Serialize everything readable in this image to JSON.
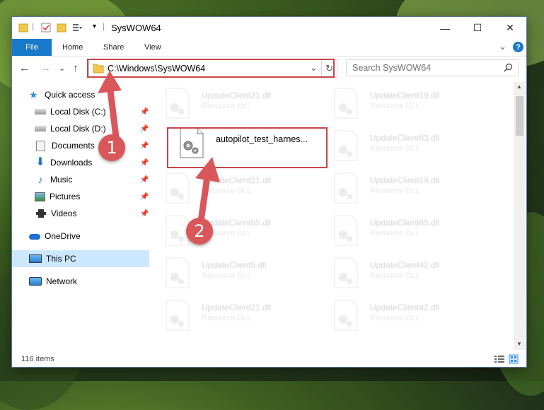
{
  "window": {
    "title": "SysWOW64",
    "minimize": "—",
    "maximize": "☐",
    "close": "✕"
  },
  "ribbon": {
    "file": "File",
    "tabs": [
      "Home",
      "Share",
      "View"
    ],
    "expand": "⌄",
    "help": "?"
  },
  "address": {
    "path": "C:\\Windows\\SysWOW64",
    "refresh": "↻",
    "dropdown": "⌄",
    "search_placeholder": "Search SysWOW64"
  },
  "nav": {
    "back": "←",
    "forward": "→",
    "recent": "⌄",
    "up": "↑"
  },
  "sidebar": {
    "quick_access": "Quick access",
    "items": [
      {
        "label": "Local Disk (C:)",
        "icon": "drive-icon",
        "pinned": true
      },
      {
        "label": "Local Disk (D:)",
        "icon": "drive-icon",
        "pinned": true
      },
      {
        "label": "Documents",
        "icon": "documents-icon",
        "pinned": true
      },
      {
        "label": "Downloads",
        "icon": "downloads-icon",
        "pinned": true
      },
      {
        "label": "Music",
        "icon": "music-icon",
        "pinned": true
      },
      {
        "label": "Pictures",
        "icon": "pictures-icon",
        "pinned": true
      },
      {
        "label": "Videos",
        "icon": "videos-icon",
        "pinned": true
      }
    ],
    "onedrive": "OneDrive",
    "thispc": "This PC",
    "network": "Network",
    "pin_glyph": "📌"
  },
  "files": {
    "highlighted": {
      "name": "autopilot_test_harnes...",
      "type": ""
    },
    "left_column": [
      {
        "name": "UpdateClient21.dll",
        "type": "Resource DLL"
      },
      {
        "name": "UpdateClient21.dll",
        "type": "Resource DLL"
      },
      {
        "name": "UpdateClient65.dll",
        "type": "Resource DLL"
      },
      {
        "name": "UpdateClient5.dll",
        "type": "Resource DLL"
      },
      {
        "name": "UpdateClient21.dll",
        "type": "Resource DLL"
      }
    ],
    "right_column": [
      {
        "name": "UpdateClient19.dll",
        "type": "Resource DLL"
      },
      {
        "name": "UpdateClient63.dll",
        "type": "Resource DLL"
      },
      {
        "name": "UpdateClient19.dll",
        "type": "Resource DLL"
      },
      {
        "name": "UpdateClient65.dll",
        "type": "Resource DLL"
      },
      {
        "name": "UpdateClient42.dll",
        "type": "Resource DLL"
      },
      {
        "name": "UpdateClient42.dll",
        "type": "Resource DLL"
      }
    ]
  },
  "status": {
    "count": "116 items"
  },
  "annotations": {
    "step1": "1",
    "step2": "2",
    "color": "#d9575b"
  },
  "colors": {
    "accent": "#1979ca",
    "highlight_border": "#c8444a",
    "selected_bg": "#cce8ff"
  }
}
